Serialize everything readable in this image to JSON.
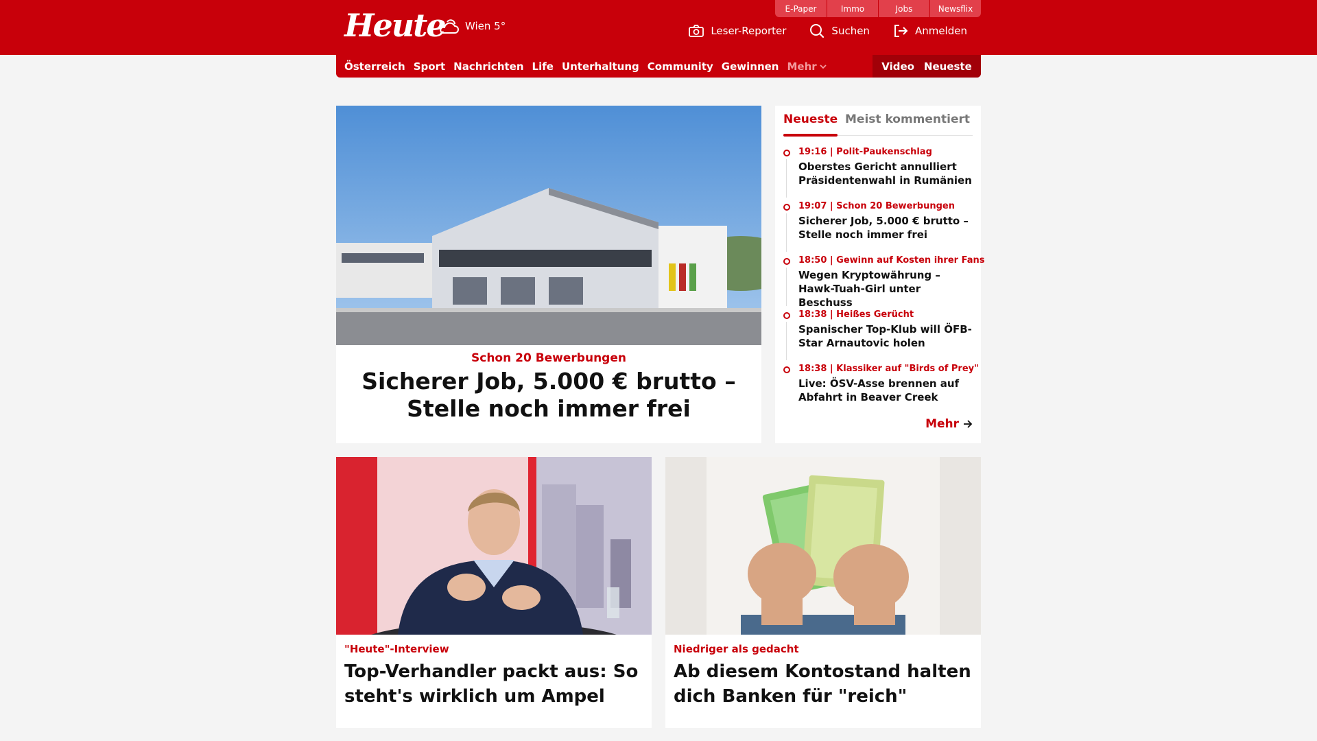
{
  "header": {
    "logo": "Heute",
    "weather": "Wien 5°",
    "service_tabs": [
      "E-Paper",
      "Immo",
      "Jobs",
      "Newsflix"
    ],
    "actions": {
      "leser_reporter": "Leser-Reporter",
      "search": "Suchen",
      "login": "Anmelden"
    }
  },
  "nav": {
    "items": [
      "Österreich",
      "Sport",
      "Nachrichten",
      "Life",
      "Unterhaltung",
      "Community",
      "Gewinnen"
    ],
    "more": "Mehr",
    "video": "Video",
    "latest": "Neueste"
  },
  "hero": {
    "kicker": "Schon 20 Bewerbungen",
    "title": "Sicherer Job, 5.000 € brutto – Stelle noch immer frei",
    "image": "Gemeindeamt building photo"
  },
  "sidebar": {
    "tab_active": "Neueste",
    "tab_inactive": "Meist kommentiert",
    "items": [
      {
        "meta": "19:16 | Polit-Paukenschlag",
        "title": "Oberstes Gericht annulliert Präsidentenwahl in Rumänien"
      },
      {
        "meta": "19:07 | Schon 20 Bewerbungen",
        "title": "Sicherer Job, 5.000 € brutto – Stelle noch immer frei"
      },
      {
        "meta": "18:50 | Gewinn auf Kosten ihrer Fans",
        "title": "Wegen Kryptowährung – Hawk-Tuah-Girl unter Beschuss"
      },
      {
        "meta": "18:38 | Heißes Gerücht",
        "title": "Spanischer Top-Klub will ÖFB-Star Arnautovic holen"
      },
      {
        "meta": "18:38 | Klassiker auf \"Birds of Prey\"",
        "title": "Live: ÖSV-Asse brennen auf Abfahrt in Beaver Creek"
      }
    ],
    "more": "Mehr"
  },
  "cards": [
    {
      "kicker": "\"Heute\"-Interview",
      "title": "Top-Verhandler packt aus: So steht's wirklich um Ampel"
    },
    {
      "kicker": "Niedriger als gedacht",
      "title": "Ab diesem Kontostand halten dich Banken für \"reich\""
    }
  ],
  "colors": {
    "brand_red": "#c8000a",
    "dark_red": "#a10008",
    "background": "#f4f4f4"
  }
}
